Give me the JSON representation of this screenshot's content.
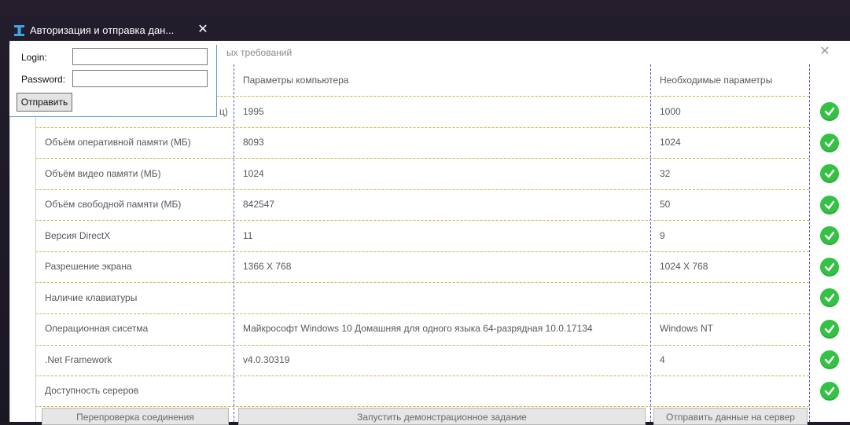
{
  "auth_dialog": {
    "title": "Авторизация и отправка дан...",
    "close_glyph": "✕",
    "login_label": "Login:",
    "password_label": "Password:",
    "login_value": "",
    "password_value": "",
    "send_label": "Отправить"
  },
  "main_window": {
    "title": "ых требований",
    "close_glyph": "✕",
    "headers": [
      "Параметры компьютера",
      "Необходимые параметры"
    ],
    "first_row_label_fragment": "ц)",
    "rows": [
      {
        "label": "",
        "computer": "1995",
        "required": "1000",
        "status": "ok"
      },
      {
        "label": "Объём оперативной памяти (МБ)",
        "computer": "8093",
        "required": "1024",
        "status": "ok"
      },
      {
        "label": "Объём видео памяти (МБ)",
        "computer": "1024",
        "required": "32",
        "status": "ok"
      },
      {
        "label": "Объём свободной памяти (МБ)",
        "computer": "842547",
        "required": "50",
        "status": "ok"
      },
      {
        "label": "Версия DirectX",
        "computer": "11",
        "required": "9",
        "status": "ok"
      },
      {
        "label": "Разрешение экрана",
        "computer": "1366 X 768",
        "required": "1024 X 768",
        "status": "ok"
      },
      {
        "label": "Наличие клавиатуры",
        "computer": "",
        "required": "",
        "status": "ok"
      },
      {
        "label": "Операционная сисетма",
        "computer": "Майкрософт Windows 10 Домашняя для одного языка 64-разрядная 10.0.17134",
        "required": "Windows NT",
        "status": "ok"
      },
      {
        "label": ".Net Framework",
        "computer": "v4.0.30319",
        "required": "4",
        "status": "ok"
      },
      {
        "label": "Доступность сереров",
        "computer": "",
        "required": "",
        "status": "ok"
      }
    ],
    "buttons": {
      "recheck": "Перепроверка соединения",
      "demo": "Запустить демонстрационное задание",
      "send_server": "Отправить данные на сервер"
    }
  },
  "colors": {
    "status_ok": "#34c244",
    "grid_vertical": "#5a55c8",
    "grid_horizontal": "#c9b53a",
    "dialog_border": "#5b9bd5"
  }
}
